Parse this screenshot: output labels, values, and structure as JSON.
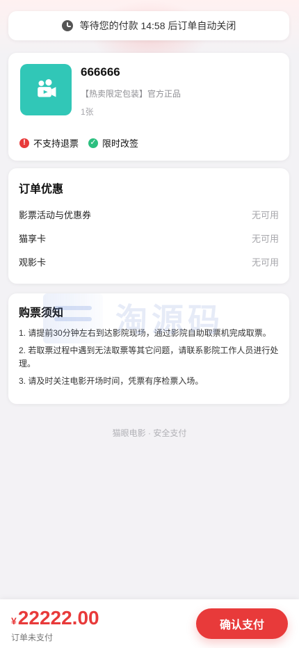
{
  "timer": {
    "text": "等待您的付款 14:58 后订单自动关闭",
    "icon": "clock-icon"
  },
  "product": {
    "title": "666666",
    "subtitle": "【热卖限定包装】官方正品",
    "qty": "1张",
    "thumb_icon": "video-camera-icon",
    "badges": [
      {
        "icon": "no-refund-icon",
        "label": "不支持退票",
        "color": "#e83a3a"
      },
      {
        "icon": "limited-change-icon",
        "label": "限时改签",
        "color": "#2bbf7f"
      }
    ]
  },
  "discount": {
    "title": "订单优惠",
    "rows": [
      {
        "label": "影票活动与优惠券",
        "value": "无可用"
      },
      {
        "label": "猫享卡",
        "value": "无可用"
      },
      {
        "label": "观影卡",
        "value": "无可用"
      }
    ]
  },
  "notice": {
    "title": "购票须知",
    "items": [
      "1. 请提前30分钟左右到达影院现场，通过影院自助取票机完成取票。",
      "2. 若取票过程中遇到无法取票等其它问题，请联系影院工作人员进行处理。",
      "3. 请及时关注电影开场时间，凭票有序检票入场。"
    ]
  },
  "watermark": {
    "text": "淘源码"
  },
  "secure_text": "猫眼电影 · 安全支付",
  "bottom": {
    "currency": "¥",
    "amount": "22222.00",
    "status": "订单未支付",
    "pay_label": "确认支付"
  }
}
